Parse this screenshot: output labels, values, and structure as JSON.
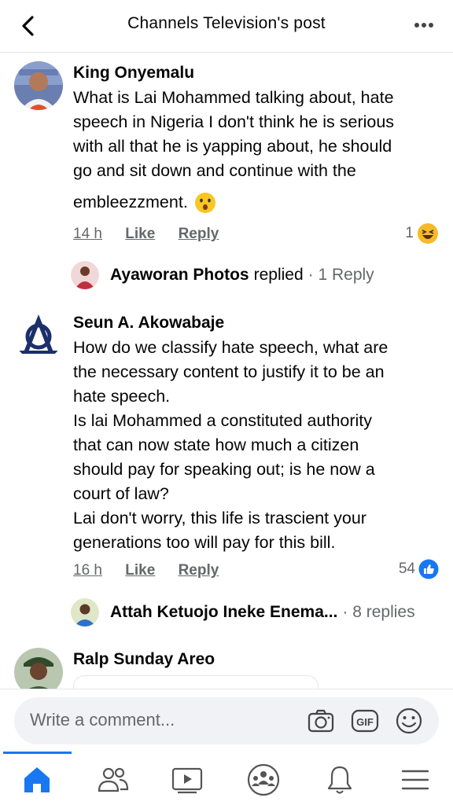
{
  "header": {
    "title": "Channels Television's post"
  },
  "comments": [
    {
      "author": "King Onyemalu",
      "lines": [
        "What is Lai Mohammed talking about, hate",
        "speech in Nigeria I don't think he is serious",
        "with all that he is yapping about, he should",
        "go and sit down and continue with the"
      ],
      "last_line": "embleezzment.",
      "time": "14 h",
      "like": "Like",
      "reply": "Reply",
      "reaction_count": "1",
      "reply_author": "Ayaworan Photos",
      "reply_action": "replied",
      "reply_count": "· 1 Reply"
    },
    {
      "author": "Seun A. Akowabaje",
      "lines": [
        "How do we  classify hate speech, what are",
        "the necessary content to justify it to be an",
        "hate speech.",
        "Is lai Mohammed a constituted authority",
        "that can now state how much a citizen",
        "should pay for speaking out;  is he now a",
        "court of law?",
        "Lai don't worry, this life is trascient your",
        "generations too will pay for this bill."
      ],
      "time": "16 h",
      "like": "Like",
      "reply": "Reply",
      "reaction_count": "54",
      "reply_author": "Attah Ketuojo Ineke Enema...",
      "reply_count": "· 8 replies"
    },
    {
      "author": "Ralp Sunday Areo"
    }
  ],
  "composer": {
    "placeholder": "Write a comment..."
  },
  "icons": {
    "back": "chevron-left-icon",
    "more": "more-dots-icon",
    "camera": "camera-icon",
    "gif": "gif-icon",
    "emoji": "emoji-icon",
    "tabs": [
      "home-icon",
      "friends-icon",
      "video-icon",
      "groups-icon",
      "bell-icon",
      "menu-icon"
    ]
  },
  "colors": {
    "accent": "#1877f2",
    "grey": "#65676b",
    "input_bg": "#f0f2f5"
  }
}
